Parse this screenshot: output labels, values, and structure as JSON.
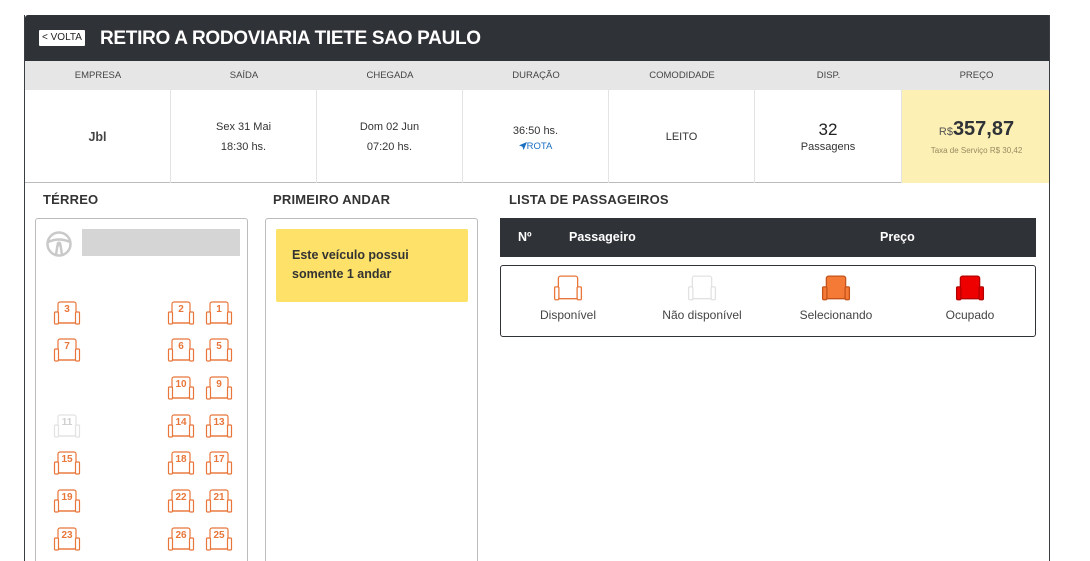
{
  "header": {
    "back_label": "< VOLTA",
    "title": "RETIRO A RODOVIARIA TIETE SAO PAULO"
  },
  "columns": [
    "EMPRESA",
    "SAÍDA",
    "CHEGADA",
    "DURAÇÃO",
    "COMODIDADE",
    "DISP.",
    "PREÇO"
  ],
  "trip": {
    "empresa": "Jbl",
    "saida_date": "Sex 31 Mai",
    "saida_time": "18:30 hs.",
    "chegada_date": "Dom 02 Jun",
    "chegada_time": "07:20 hs.",
    "duracao": "36:50 hs.",
    "rota_label": "ROTA",
    "comodidade": "LEITO",
    "disp_count": "32",
    "disp_label": "Passagens",
    "price_currency": "R$",
    "price_value": "357,87",
    "taxa": "Taxa de Serviço R$ 30,42"
  },
  "sections": {
    "terreo": "TÉRREO",
    "primeiro": "PRIMEIRO ANDAR",
    "lista": "LISTA DE PASSAGEIROS"
  },
  "seats": [
    {
      "num": "3",
      "status": "disponivel",
      "col": 0,
      "row": 0
    },
    {
      "num": "2",
      "status": "disponivel",
      "col": 2,
      "row": 0
    },
    {
      "num": "1",
      "status": "disponivel",
      "col": 3,
      "row": 0
    },
    {
      "num": "7",
      "status": "disponivel",
      "col": 0,
      "row": 1
    },
    {
      "num": "6",
      "status": "disponivel",
      "col": 2,
      "row": 1
    },
    {
      "num": "5",
      "status": "disponivel",
      "col": 3,
      "row": 1
    },
    {
      "num": "10",
      "status": "disponivel",
      "col": 2,
      "row": 2
    },
    {
      "num": "9",
      "status": "disponivel",
      "col": 3,
      "row": 2
    },
    {
      "num": "11",
      "status": "nao_disponivel",
      "col": 0,
      "row": 3
    },
    {
      "num": "14",
      "status": "disponivel",
      "col": 2,
      "row": 3
    },
    {
      "num": "13",
      "status": "disponivel",
      "col": 3,
      "row": 3
    },
    {
      "num": "15",
      "status": "disponivel",
      "col": 0,
      "row": 4
    },
    {
      "num": "18",
      "status": "disponivel",
      "col": 2,
      "row": 4
    },
    {
      "num": "17",
      "status": "disponivel",
      "col": 3,
      "row": 4
    },
    {
      "num": "19",
      "status": "disponivel",
      "col": 0,
      "row": 5
    },
    {
      "num": "22",
      "status": "disponivel",
      "col": 2,
      "row": 5
    },
    {
      "num": "21",
      "status": "disponivel",
      "col": 3,
      "row": 5
    },
    {
      "num": "23",
      "status": "disponivel",
      "col": 0,
      "row": 6
    },
    {
      "num": "26",
      "status": "disponivel",
      "col": 2,
      "row": 6
    },
    {
      "num": "25",
      "status": "disponivel",
      "col": 3,
      "row": 6
    }
  ],
  "notice": "Este veículo possui somente 1 andar",
  "passenger_list": {
    "col_num": "Nº",
    "col_passageiro": "Passageiro",
    "col_preco": "Preço"
  },
  "legend": [
    {
      "label": "Disponível",
      "stroke": "#e8763a",
      "fill": "#ffffff"
    },
    {
      "label": "Não disponível",
      "stroke": "#e2e2e2",
      "fill": "#ffffff"
    },
    {
      "label": "Selecionando",
      "stroke": "#c4531b",
      "fill": "#f47a36"
    },
    {
      "label": "Ocupado",
      "stroke": "#b30000",
      "fill": "#ee0000"
    }
  ],
  "colors": {
    "dark": "#2f3237",
    "seat_available": "#e8763a",
    "price_bg": "#fdf0b5",
    "notice_bg": "#fde168"
  }
}
